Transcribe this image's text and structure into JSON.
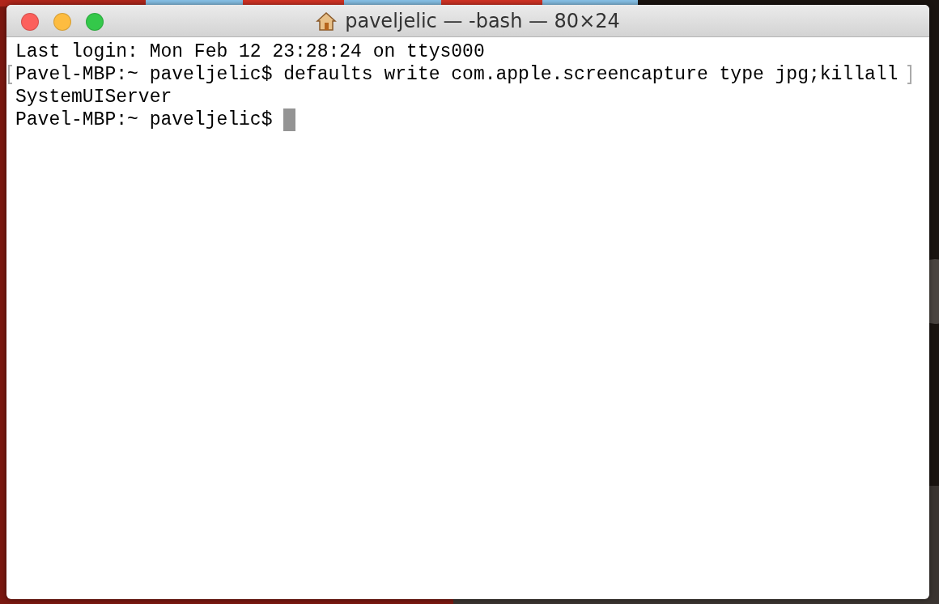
{
  "window": {
    "title": "paveljelic — -bash — 80×24"
  },
  "terminal": {
    "lines": [
      {
        "text": "Last login: Mon Feb 12 23:28:24 on ttys000",
        "marked": false,
        "cursor": false
      },
      {
        "text": "Pavel-MBP:~ paveljelic$ defaults write com.apple.screencapture type jpg;killall",
        "marked": true,
        "cursor": false
      },
      {
        "text": "SystemUIServer",
        "marked": false,
        "cursor": false
      },
      {
        "text": "Pavel-MBP:~ paveljelic$ ",
        "marked": false,
        "cursor": true
      }
    ]
  }
}
